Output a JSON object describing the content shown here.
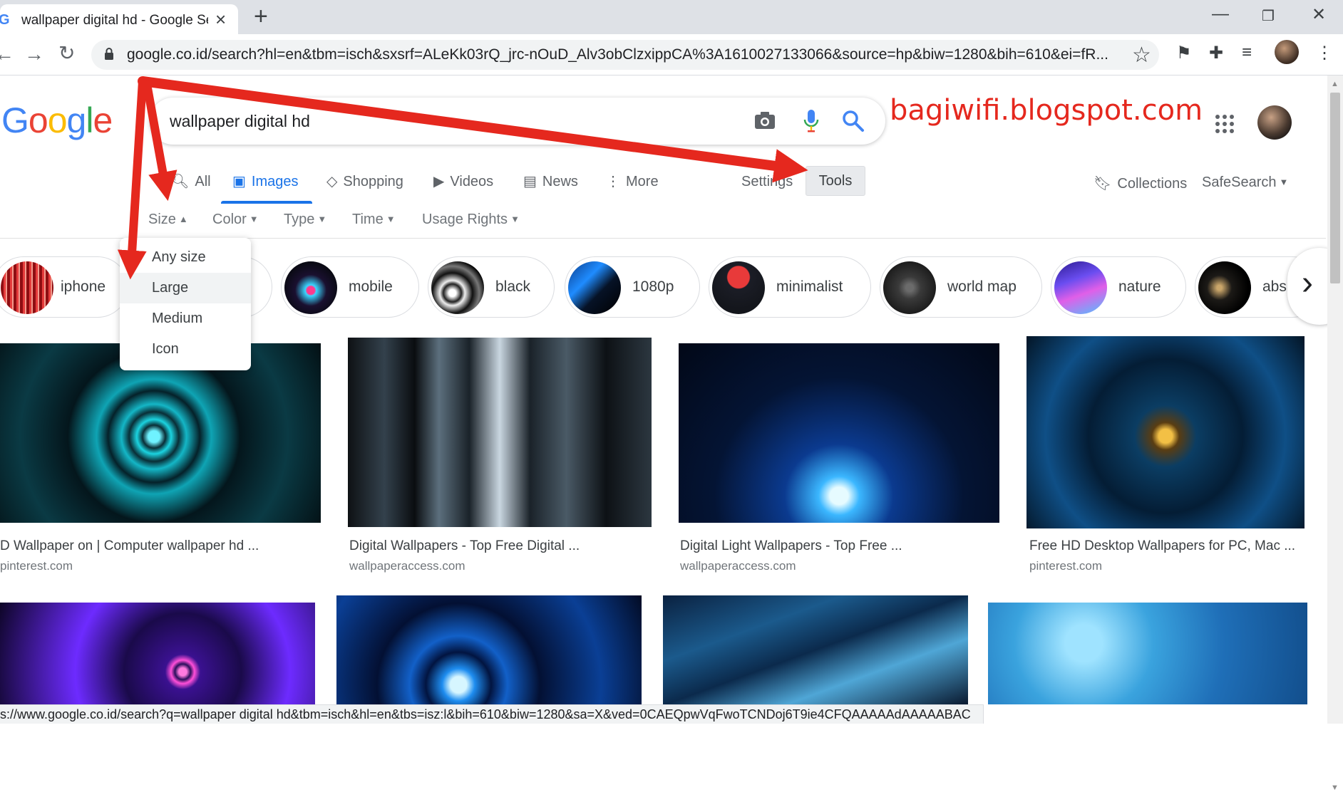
{
  "browser": {
    "tab_title": "wallpaper digital hd - Google Sea",
    "url": "google.co.id/search?hl=en&tbm=isch&sxsrf=ALeKk03rQ_jrc-nOuD_Alv3obClzxippCA%3A1610027133066&source=hp&biw=1280&bih=610&ei=fR...",
    "status_url": "s://www.google.co.id/search?q=wallpaper digital hd&tbm=isch&hl=en&tbs=isz:l&bih=610&biw=1280&sa=X&ved=0CAEQpwVqFwoTCNDoj6T9ie4CFQAAAAAdAAAAABAC"
  },
  "search": {
    "query": "wallpaper digital hd",
    "watermark": "bagiwifi.blogspot.com"
  },
  "nav_tabs": [
    {
      "label": "All",
      "icon": "search-icon"
    },
    {
      "label": "Images",
      "icon": "image-icon",
      "active": true
    },
    {
      "label": "Shopping",
      "icon": "tag-icon"
    },
    {
      "label": "Videos",
      "icon": "play-icon"
    },
    {
      "label": "News",
      "icon": "news-icon"
    },
    {
      "label": "More",
      "icon": "more-vert-icon"
    }
  ],
  "settings_label": "Settings",
  "tools_label": "Tools",
  "collections_label": "Collections",
  "safesearch_label": "SafeSearch",
  "filters": [
    "Size",
    "Color",
    "Type",
    "Time",
    "Usage Rights"
  ],
  "size_menu": [
    "Any size",
    "Large",
    "Medium",
    "Icon"
  ],
  "size_menu_highlighted": "Large",
  "chips": [
    "iphone",
    "mobile",
    "black",
    "1080p",
    "minimalist",
    "world map",
    "nature",
    "abs"
  ],
  "results": [
    {
      "title": "D Wallpaper on | Computer wallpaper hd ...",
      "source": "pinterest.com"
    },
    {
      "title": "Digital Wallpapers - Top Free Digital ...",
      "source": "wallpaperaccess.com"
    },
    {
      "title": "Digital Light Wallpapers - Top Free ...",
      "source": "wallpaperaccess.com"
    },
    {
      "title": "Free HD Desktop Wallpapers for PC, Mac ...",
      "source": "pinterest.com"
    }
  ],
  "colors": {
    "accent_blue": "#1a73e8",
    "annotation_red": "#e5281e",
    "google_blue": "#4285f4",
    "google_red": "#ea4335",
    "google_yellow": "#fbbc05",
    "google_green": "#34a853"
  }
}
